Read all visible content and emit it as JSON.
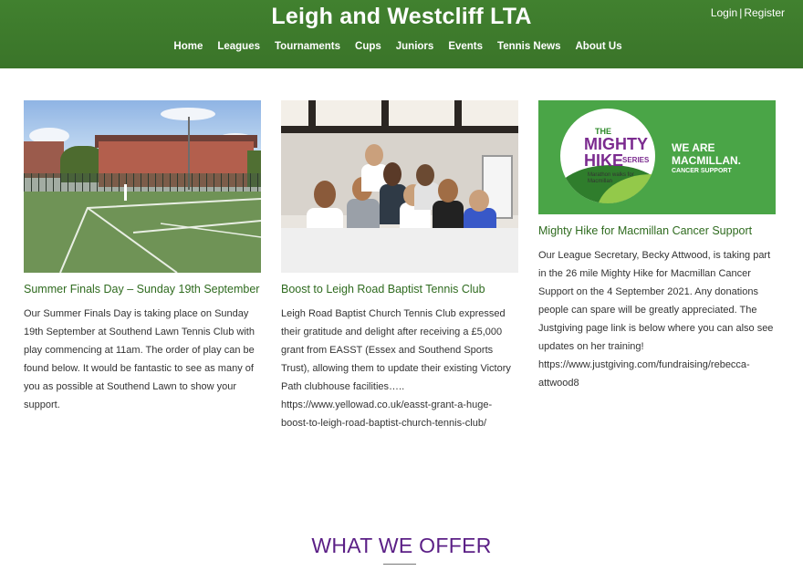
{
  "site": {
    "title": "Leigh and Westcliff LTA"
  },
  "auth": {
    "login": "Login",
    "separator": "|",
    "register": "Register"
  },
  "nav": {
    "items": [
      "Home",
      "Leagues",
      "Tournaments",
      "Cups",
      "Juniors",
      "Events",
      "Tennis News",
      "About Us"
    ]
  },
  "posts": [
    {
      "title": "Summer Finals Day – Sunday 19th September",
      "body": "Our Summer Finals Day is taking place on Sunday 19th September at Southend Lawn Tennis Club with play commencing at 11am. The order of play can be found below. It would be fantastic to see as many of you as possible at Southend Lawn to show your support."
    },
    {
      "title": "Boost to Leigh Road Baptist Tennis Club",
      "body": "Leigh Road Baptist Church Tennis Club expressed their gratitude and delight after receiving a £5,000 grant from EASST (Essex and Southend Sports Trust), allowing them to update their existing Victory Path clubhouse facilities….. https://www.yellowad.co.uk/easst-grant-a-huge-boost-to-leigh-road-baptist-church-tennis-club/"
    },
    {
      "title": "Mighty Hike for Macmillan Cancer Support",
      "body": "Our League Secretary, Becky Attwood, is taking part in the 26 mile Mighty Hike for Macmillan Cancer Support on the 4 September 2021. Any donations people can spare will be greatly appreciated. The Justgiving page link is below where you can also see updates on her training! https://www.justgiving.com/fundraising/rebecca-attwood8"
    }
  ],
  "logo": {
    "the": "THE",
    "mighty": "MIGHTY",
    "hike": "HIKE",
    "series": "SERIES",
    "subtitle": "Marathon walks for Macmillan",
    "we_are": "WE ARE",
    "macmillan": "MACMILLAN.",
    "cancer_support": "CANCER SUPPORT"
  },
  "section": {
    "heading": "WHAT WE OFFER"
  },
  "colors": {
    "header_green": "#3d7a2e",
    "title_green": "#2f6b1f",
    "heading_purple": "#5b1f86"
  }
}
